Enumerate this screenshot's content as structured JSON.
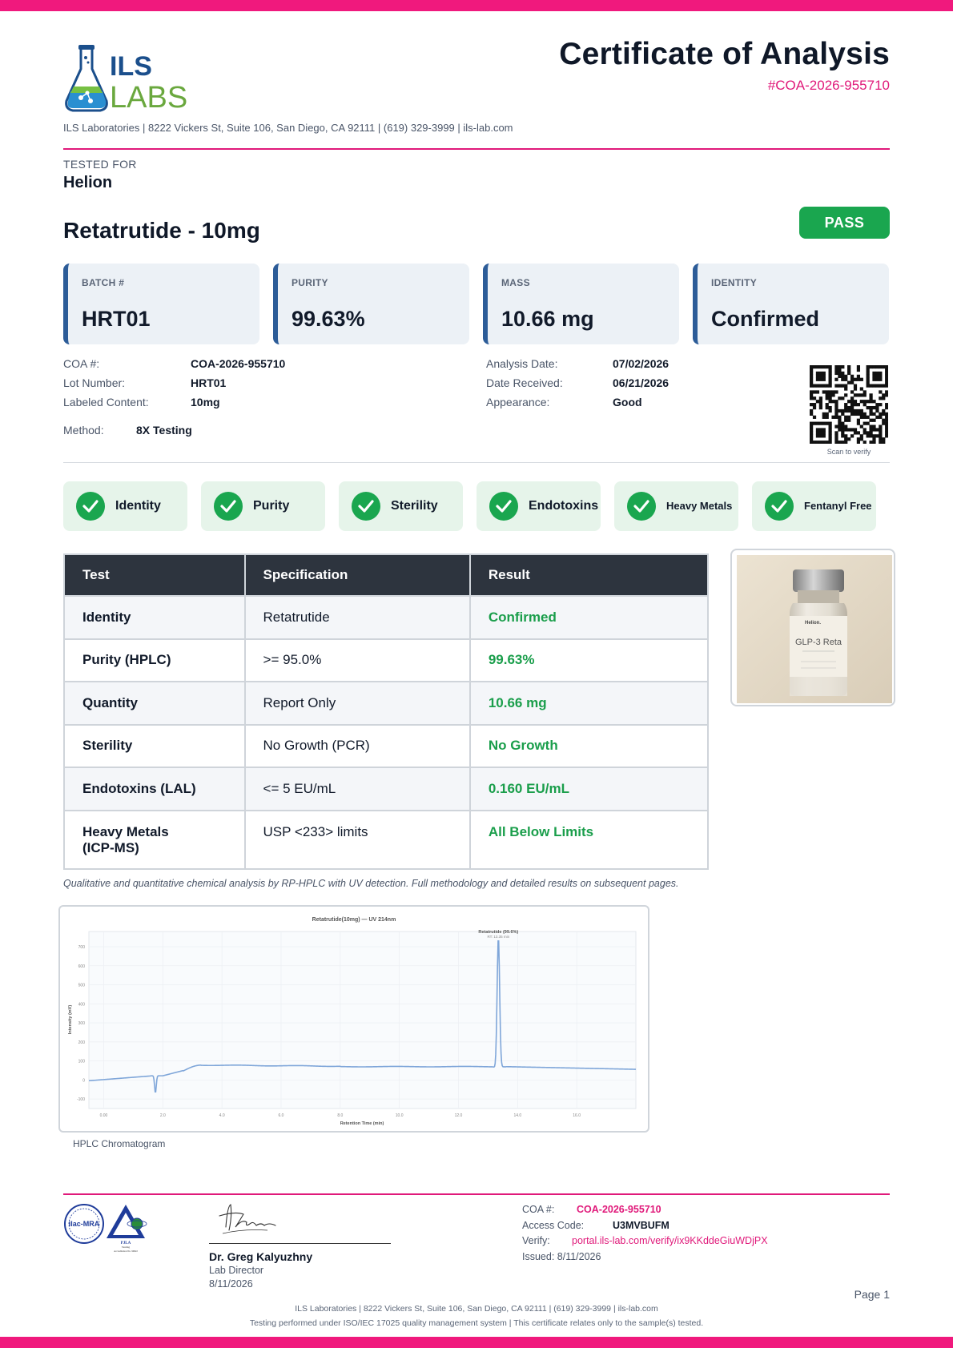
{
  "colors": {
    "accent_pink": "#e0197a",
    "band_pink": "#f0197d",
    "pass_green": "#1aa64f",
    "navy": "#0f1828",
    "card_border_blue": "#2c5c98",
    "table_header": "#2d343e"
  },
  "header": {
    "logo_text_top": "ILS",
    "logo_text_bottom": "LABS",
    "title": "Certificate of Analysis",
    "coa_number": "#COA-2026-955710",
    "address_line": "ILS Laboratories  |  8222 Vickers St, Suite 106, San Diego, CA 92111  |  (619) 329-3999  |  ils-lab.com"
  },
  "client": {
    "label": "TESTED FOR",
    "name": "Helion"
  },
  "product": {
    "title": "Retatrutide - 10mg",
    "status_badge": "PASS"
  },
  "stats": [
    {
      "label": "BATCH #",
      "value": "HRT01"
    },
    {
      "label": "PURITY",
      "value": "99.63%"
    },
    {
      "label": "MASS",
      "value": "10.66 mg"
    },
    {
      "label": "IDENTITY",
      "value": "Confirmed"
    }
  ],
  "info_left": [
    {
      "label": "COA #:",
      "value": "COA-2026-955710"
    },
    {
      "label": "Lot Number:",
      "value": "HRT01"
    },
    {
      "label": "Labeled Content:",
      "value": "10mg"
    }
  ],
  "info_right": [
    {
      "label": "Analysis Date:",
      "value": "07/02/2026"
    },
    {
      "label": "Date Received:",
      "value": "06/21/2026"
    },
    {
      "label": "Appearance:",
      "value": "Good"
    }
  ],
  "method": {
    "label": "Method:",
    "value": "8X Testing"
  },
  "qr": {
    "icon": "qr-code-icon",
    "caption": "Scan to verify"
  },
  "tests_passed": [
    {
      "label": "Identity",
      "icon": "check-circle-icon"
    },
    {
      "label": "Purity",
      "icon": "check-circle-icon"
    },
    {
      "label": "Sterility",
      "icon": "check-circle-icon"
    },
    {
      "label": "Endotoxins",
      "icon": "check-circle-icon"
    },
    {
      "label": "Heavy Metals",
      "icon": "check-circle-icon"
    },
    {
      "label": "Fentanyl Free",
      "icon": "check-circle-icon"
    }
  ],
  "results_table": {
    "headers": [
      "Test",
      "Specification",
      "Result"
    ],
    "rows": [
      {
        "test": "Identity",
        "spec": "Retatrutide",
        "result": "Confirmed"
      },
      {
        "test": "Purity (HPLC)",
        "spec": ">= 95.0%",
        "result": "99.63%"
      },
      {
        "test": "Quantity",
        "spec": "Report Only",
        "result": "10.66 mg"
      },
      {
        "test": "Sterility",
        "spec": "No Growth (PCR)",
        "result": "No Growth"
      },
      {
        "test": "Endotoxins (LAL)",
        "spec": "<= 5 EU/mL",
        "result": "0.160 EU/mL"
      },
      {
        "test": "Heavy Metals (ICP-MS)",
        "spec": "USP <233> limits",
        "result": "All Below Limits"
      }
    ]
  },
  "vial_photo": {
    "brand": "Helion.",
    "label": "GLP-3 Reta"
  },
  "method_note": "Qualitative and quantitative chemical analysis by RP-HPLC with UV detection. Full methodology and detailed results on subsequent pages.",
  "chromatogram": {
    "title": "Retatrutide(10mg) — UV 214nm",
    "peak_label": "Retatrutide (99.6%)",
    "peak_sublabel": "RT: 13.35 min",
    "xlabel": "Retention Time (min)",
    "ylabel": "Intensity (mV)",
    "x_ticks": [
      "0.00",
      "2.0",
      "4.0",
      "6.0",
      "8.0",
      "10.0",
      "12.0",
      "14.0",
      "16.0"
    ],
    "y_ticks": [
      "-100",
      "0",
      "100",
      "200",
      "300",
      "400",
      "500",
      "600",
      "700"
    ],
    "caption": "HPLC Chromatogram"
  },
  "signature": {
    "name": "Dr. Greg Kalyuzhny",
    "role": "Lab Director",
    "date": "8/11/2026"
  },
  "accreditation": {
    "ilac": "ilac-MRA",
    "pjla_name": "PJLA",
    "pjla_sub": "Testing",
    "pjla_acc": "Accreditation No. 99622"
  },
  "verification": {
    "coa_label": "COA #:",
    "coa_value": "COA-2026-955710",
    "access_label": "Access Code:",
    "access_value": "U3MVBUFM",
    "verify_label": "Verify:",
    "verify_url": "portal.ils-lab.com/verify/ix9KKddeGiuWDjPX",
    "issued": "Issued: 8/11/2026"
  },
  "footer": {
    "page": "Page 1",
    "line1": "ILS Laboratories  |  8222 Vickers St, Suite 106, San Diego, CA 92111  |  (619) 329-3999  |  ils-lab.com",
    "line2": "Testing performed under ISO/IEC 17025 quality management system  |  This certificate relates only to the sample(s) tested."
  }
}
